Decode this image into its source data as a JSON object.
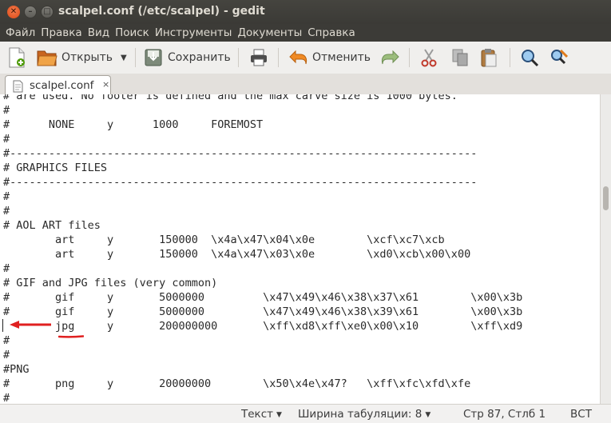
{
  "window": {
    "title": "scalpel.conf (/etc/scalpel) - gedit"
  },
  "menu": [
    "Файл",
    "Правка",
    "Вид",
    "Поиск",
    "Инструменты",
    "Документы",
    "Справка"
  ],
  "toolbar": {
    "new_icon": "new-document-icon",
    "open_label": "Открыть",
    "save_label": "Сохранить",
    "undo_label": "Отменить"
  },
  "tab": {
    "label": "scalpel.conf",
    "close": "×"
  },
  "editor": {
    "lines": [
      "# are used. No footer is defined and the max carve size is 1000 bytes.",
      "#",
      "#      NONE     y      1000     FOREMOST",
      "#",
      "#------------------------------------------------------------------------",
      "# GRAPHICS FILES",
      "#------------------------------------------------------------------------",
      "#",
      "#",
      "# AOL ART files",
      "        art     y       150000  \\x4a\\x47\\x04\\x0e        \\xcf\\xc7\\xcb",
      "        art     y       150000  \\x4a\\x47\\x03\\x0e        \\xd0\\xcb\\x00\\x00",
      "#",
      "# GIF and JPG files (very common)",
      "#       gif     y       5000000         \\x47\\x49\\x46\\x38\\x37\\x61        \\x00\\x3b",
      "#       gif     y       5000000         \\x47\\x49\\x46\\x38\\x39\\x61        \\x00\\x3b",
      "        jpg     y       200000000       \\xff\\xd8\\xff\\xe0\\x00\\x10        \\xff\\xd9",
      "#",
      "#",
      "#PNG",
      "#       png     y       20000000        \\x50\\x4e\\x47?   \\xff\\xfc\\xfd\\xfe",
      "#"
    ],
    "cursor_line": 17
  },
  "status": {
    "syntax": "Текст",
    "tab_width": "Ширина табуляции: 8",
    "position": "Стр 87, Стлб 1",
    "mode": "ВСТ"
  },
  "colors": {
    "annotation": "#e02020",
    "titlebar": "#3c3b37",
    "close_button": "#dd4814"
  }
}
